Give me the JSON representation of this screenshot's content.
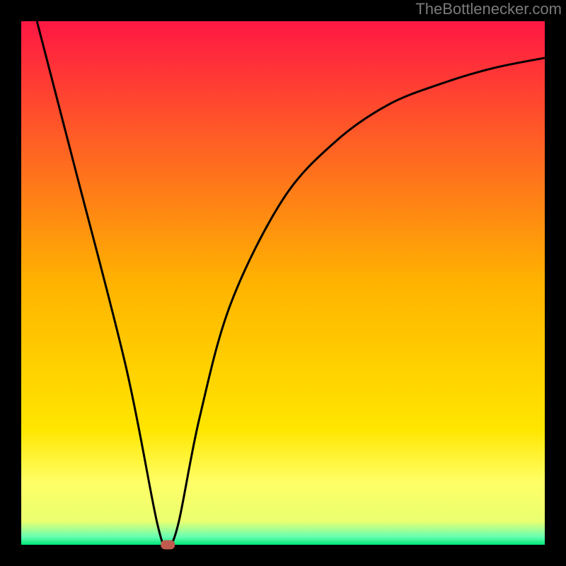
{
  "attribution": "TheBottlenecker.com",
  "chart_data": {
    "type": "line",
    "title": "",
    "xlabel": "",
    "ylabel": "",
    "xlim": [
      0,
      100
    ],
    "ylim": [
      0,
      100
    ],
    "grid": false,
    "series": [
      {
        "name": "curve",
        "x": [
          3,
          10,
          20,
          26,
          28,
          30,
          34,
          40,
          50,
          60,
          70,
          80,
          90,
          100
        ],
        "y": [
          100,
          73,
          34,
          4,
          0,
          4,
          24,
          46,
          66,
          77,
          84,
          88,
          91,
          93
        ]
      }
    ],
    "marker": {
      "x": 28,
      "y": 0,
      "color": "#c05a4e"
    },
    "background": {
      "type": "vertical-gradient",
      "stops": [
        {
          "pos": 0.0,
          "color": "#ff1744"
        },
        {
          "pos": 0.5,
          "color": "#ffb300"
        },
        {
          "pos": 0.78,
          "color": "#ffe600"
        },
        {
          "pos": 0.88,
          "color": "#ffff66"
        },
        {
          "pos": 0.955,
          "color": "#eaff70"
        },
        {
          "pos": 0.985,
          "color": "#66ffb3"
        },
        {
          "pos": 1.0,
          "color": "#00e676"
        }
      ]
    },
    "border": {
      "color": "#000000",
      "width": 30
    }
  }
}
